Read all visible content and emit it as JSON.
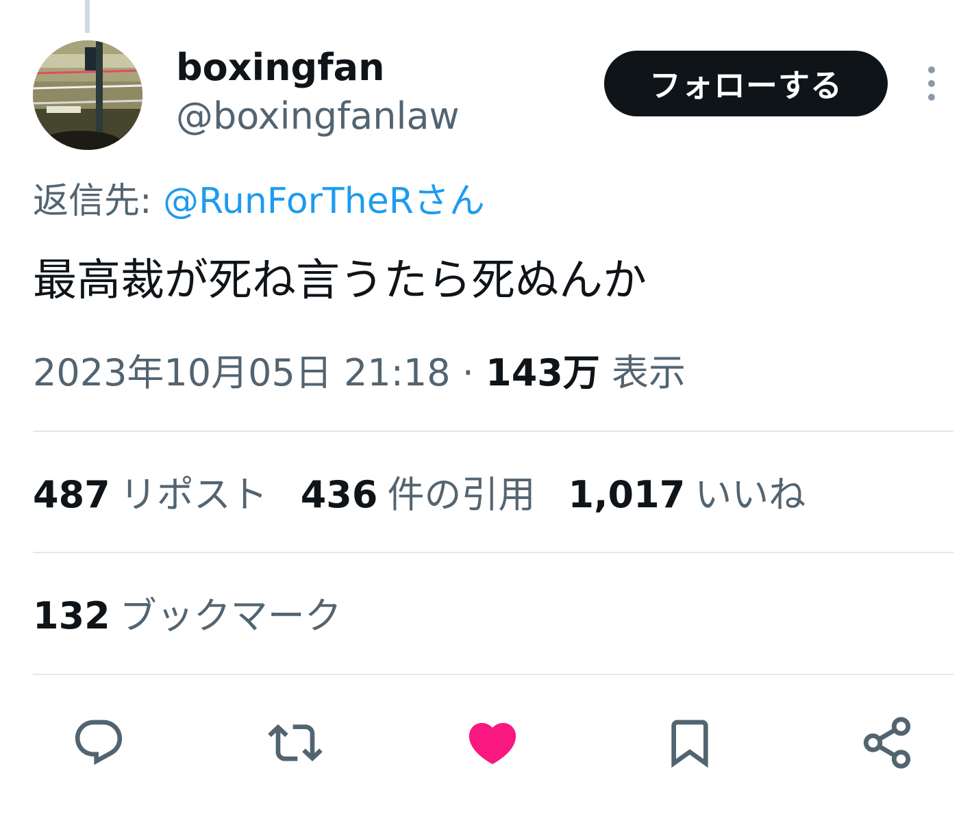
{
  "author": {
    "display_name": "boxingfan",
    "handle": "@boxingfanlaw",
    "avatar_icon": "boxing-ring-avatar"
  },
  "follow_button": {
    "label": "フォローする"
  },
  "more_icon": "more-vertical-icon",
  "reply": {
    "prefix": "返信先: ",
    "mention": "@RunForTheRさん"
  },
  "tweet": {
    "text": "最高裁が死ね言うたら死ぬんか"
  },
  "meta": {
    "datetime": "2023年10月05日 21:18",
    "separator": " · ",
    "views_count": "143万",
    "views_label": "表示"
  },
  "stats": {
    "reposts": {
      "count": "487",
      "label": "リポスト"
    },
    "quotes": {
      "count": "436",
      "label": "件の引用"
    },
    "likes": {
      "count": "1,017",
      "label": "いいね"
    },
    "bookmarks": {
      "count": "132",
      "label": "ブックマーク"
    }
  },
  "actions": [
    {
      "icon": "reply-icon"
    },
    {
      "icon": "repost-icon"
    },
    {
      "icon": "like-icon",
      "active": true
    },
    {
      "icon": "bookmark-icon"
    },
    {
      "icon": "share-icon"
    }
  ],
  "colors": {
    "text_primary": "#0f1419",
    "text_secondary": "#536471",
    "link": "#1d9bf0",
    "like_active": "#f91880",
    "divider": "#e1e8ed"
  }
}
